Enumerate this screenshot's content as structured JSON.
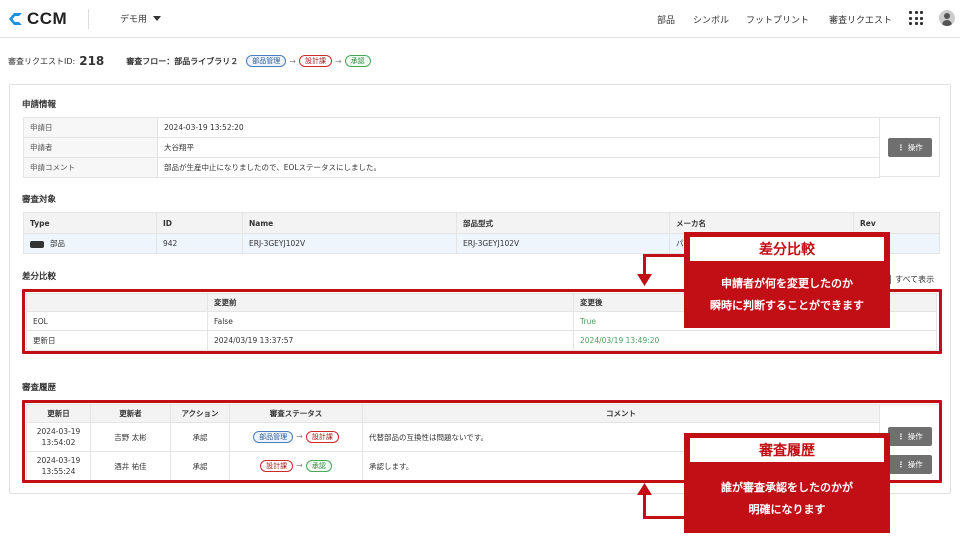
{
  "app": {
    "name": "CCM",
    "tenant": "デモ用"
  },
  "nav": [
    "部品",
    "シンボル",
    "フットプリント",
    "審査リクエスト"
  ],
  "request": {
    "id_label": "審査リクエストID:",
    "id": "218",
    "flow_label": "審査フロー：部品ライブラリ２",
    "flow": [
      "部品管理",
      "設計課",
      "承認"
    ]
  },
  "application": {
    "title": "申請情報",
    "rows": [
      {
        "k": "申請日",
        "v": "2024-03-19 13:52:20"
      },
      {
        "k": "申請者",
        "v": "大谷翔平"
      },
      {
        "k": "申請コメント",
        "v": "部品が生産中止になりましたので、EOLステータスにしました。"
      }
    ],
    "action_label": "操作"
  },
  "target": {
    "title": "審査対象",
    "headers": [
      "Type",
      "ID",
      "Name",
      "部品型式",
      "メーカ名",
      "Rev"
    ],
    "row": [
      "部品",
      "942",
      "ERJ-3GEYJ102V",
      "ERJ-3GEYJ102V",
      "パ",
      ""
    ]
  },
  "diff": {
    "title": "差分比較",
    "show_all": "すべて表示",
    "headers": [
      "",
      "変更前",
      "変更後"
    ],
    "rows": [
      [
        "EOL",
        "False",
        "True"
      ],
      [
        "更新日",
        "2024/03/19 13:37:57",
        "2024/03/19 13:49:20"
      ]
    ]
  },
  "history": {
    "title": "審査履歴",
    "headers": [
      "更新日",
      "更新者",
      "アクション",
      "審査ステータス",
      "コメント"
    ],
    "rows": [
      {
        "date1": "2024-03-19",
        "date2": "13:54:02",
        "user": "吉野 太彬",
        "action": "承認",
        "from": "部品管理",
        "to": "設計課",
        "comment": "代替部品の互換性は問題ないです。"
      },
      {
        "date1": "2024-03-19",
        "date2": "13:55:24",
        "user": "酒井 祐佳",
        "action": "承認",
        "from": "設計課",
        "to": "承認",
        "comment": "承認します。"
      }
    ],
    "action_label": "操作"
  },
  "callouts": [
    {
      "title": "差分比較",
      "lines": [
        "申請者が何を変更したのか",
        "瞬時に判断することができます"
      ]
    },
    {
      "title": "審査履歴",
      "lines": [
        "誰が審査承認をしたのかが",
        "明確になります"
      ]
    }
  ],
  "colors": {
    "accent_red": "#c20f16",
    "logo_blue": "#1f8fe0",
    "pill_blue": "#4a7cc0",
    "pill_red": "#cc2a2a",
    "pill_green": "#47a65a"
  },
  "icons": [
    "ccm-logo-icon",
    "chevron-down-icon",
    "apps-grid-icon",
    "user-avatar-icon",
    "part-chip-icon",
    "kebab-icon",
    "checkbox-icon",
    "arrow-icon"
  ]
}
